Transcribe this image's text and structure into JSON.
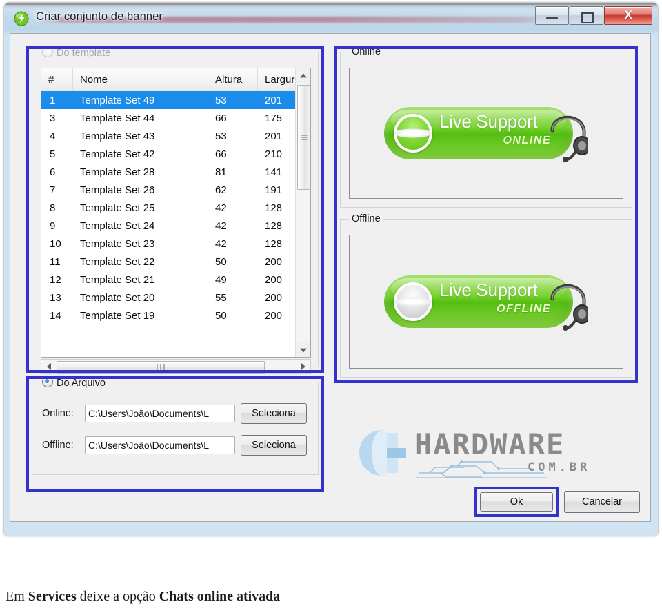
{
  "window": {
    "title": "Criar conjunto de banner",
    "icon": "green-swoosh-icon",
    "buttons": {
      "minimize": "minimize-icon",
      "maximize": "maximize-icon",
      "close": "X"
    }
  },
  "template_group": {
    "label": "Do template",
    "radio_checked": false,
    "enabled": false,
    "columns": [
      "#",
      "Nome",
      "Altura",
      "Largura"
    ],
    "rows": [
      {
        "num": "1",
        "nome": "Template Set 49",
        "altura": "53",
        "largura": "201",
        "selected": true
      },
      {
        "num": "3",
        "nome": "Template Set 44",
        "altura": "66",
        "largura": "175",
        "selected": false
      },
      {
        "num": "4",
        "nome": "Template Set 43",
        "altura": "53",
        "largura": "201",
        "selected": false
      },
      {
        "num": "5",
        "nome": "Template Set 42",
        "altura": "66",
        "largura": "210",
        "selected": false
      },
      {
        "num": "6",
        "nome": "Template Set 28",
        "altura": "81",
        "largura": "141",
        "selected": false
      },
      {
        "num": "7",
        "nome": "Template Set 26",
        "altura": "62",
        "largura": "191",
        "selected": false
      },
      {
        "num": "8",
        "nome": "Template Set 25",
        "altura": "42",
        "largura": "128",
        "selected": false
      },
      {
        "num": "9",
        "nome": "Template Set 24",
        "altura": "42",
        "largura": "128",
        "selected": false
      },
      {
        "num": "10",
        "nome": "Template Set 23",
        "altura": "42",
        "largura": "128",
        "selected": false
      },
      {
        "num": "11",
        "nome": "Template Set 22",
        "altura": "50",
        "largura": "200",
        "selected": false
      },
      {
        "num": "12",
        "nome": "Template Set 21",
        "altura": "49",
        "largura": "200",
        "selected": false
      },
      {
        "num": "13",
        "nome": "Template Set 20",
        "altura": "55",
        "largura": "200",
        "selected": false
      },
      {
        "num": "14",
        "nome": "Template Set 19",
        "altura": "50",
        "largura": "200",
        "selected": false
      }
    ]
  },
  "arquivo_group": {
    "label": "Do Arquivo",
    "radio_checked": true,
    "online_label": "Online:",
    "online_path": "C:\\Users\\João\\Documents\\L",
    "online_button": "Seleciona",
    "offline_label": "Offline:",
    "offline_path": "C:\\Users\\João\\Documents\\L",
    "offline_button": "Seleciona"
  },
  "preview": {
    "online": {
      "group_label": "Online",
      "banner_text": "Live Support",
      "banner_status": "ONLINE"
    },
    "offline": {
      "group_label": "Offline",
      "banner_text": "Live Support",
      "banner_status": "OFFLINE"
    }
  },
  "watermark": {
    "text": "HARDWARE",
    "subtext": "COM.BR"
  },
  "dialog_buttons": {
    "ok": "Ok",
    "cancel": "Cancelar"
  },
  "caption": {
    "part1": "Em ",
    "bold1": "Services",
    "part2": " deixe a opção ",
    "bold2": "Chats online ativada"
  },
  "colors": {
    "highlight": "#3333cc",
    "selection": "#1a8ceb",
    "banner_green": "#6ecf25",
    "close_red": "#c53a2e"
  }
}
